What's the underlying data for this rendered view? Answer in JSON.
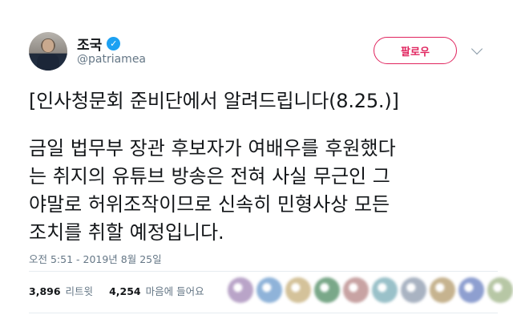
{
  "user": {
    "name": "조국",
    "handle": "@patriamea",
    "verified_icon": "verified-badge-icon"
  },
  "follow_button": {
    "label": "팔로우",
    "color": "#e0245e"
  },
  "tweet": {
    "heading": "[인사청문회 준비단에서 알려드립니다(8.25.)]",
    "lines": [
      "금일 법무부 장관 후보자가 여배우를 후원했다",
      "는 취지의 유튜브 방송은 전혀 사실 무근인 그",
      "야말로 허위조작이므로 신속히 민형사상 모든",
      "조치를 취할 예정입니다."
    ],
    "timestamp": "오전 5:51 - 2019년 8월 25일"
  },
  "stats": {
    "retweets_count": "3,896",
    "retweets_label": "리트윗",
    "likes_count": "4,254",
    "likes_label": "마음에 들어요"
  },
  "liker_colors": [
    "#b9a4c8",
    "#8fb3d9",
    "#d4c29a",
    "#7aa889",
    "#c8a3a3",
    "#9ac1c9",
    "#a9b3c2",
    "#c6b38f",
    "#8e9fd0",
    "#b7c7a5"
  ]
}
